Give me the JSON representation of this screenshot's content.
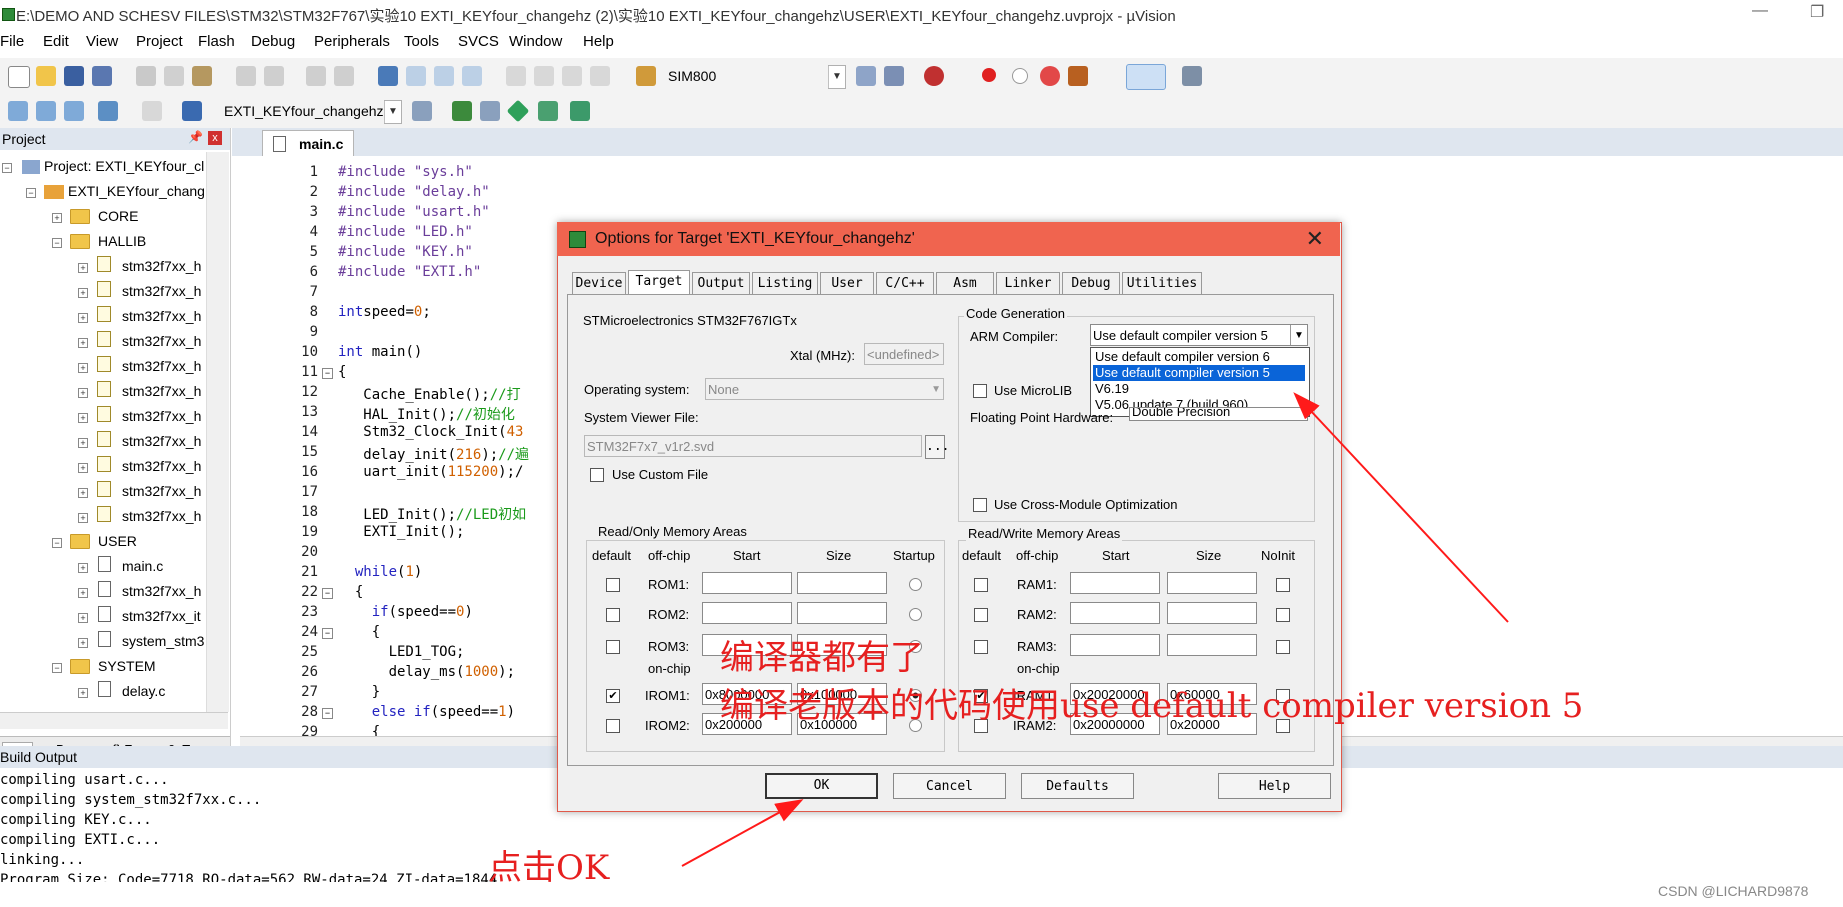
{
  "window": {
    "title": "E:\\DEMO AND SCHESV FILES\\STM32\\STM32F767\\实验10 EXTI_KEYfour_changehz (2)\\实验10 EXTI_KEYfour_changehz\\USER\\EXTI_KEYfour_changehz.uvprojx - µVision",
    "minimize": "—",
    "restore": "❐"
  },
  "menu": [
    "File",
    "Edit",
    "View",
    "Project",
    "Flash",
    "Debug",
    "Peripherals",
    "Tools",
    "SVCS",
    "Window",
    "Help"
  ],
  "toolbar": {
    "device_label": "SIM800",
    "target_label": "EXTI_KEYfour_changehz"
  },
  "project": {
    "header": "Project",
    "root": "Project: EXTI_KEYfour_cl",
    "target": "EXTI_KEYfour_chang",
    "groups": {
      "core": "CORE",
      "hallib": "HALLIB",
      "hallib_files": [
        "stm32f7xx_h",
        "stm32f7xx_h",
        "stm32f7xx_h",
        "stm32f7xx_h",
        "stm32f7xx_h",
        "stm32f7xx_h",
        "stm32f7xx_h",
        "stm32f7xx_h",
        "stm32f7xx_h",
        "stm32f7xx_h",
        "stm32f7xx_h"
      ],
      "user": "USER",
      "user_files": [
        "main.c",
        "stm32f7xx_h",
        "stm32f7xx_it",
        "system_stm3"
      ],
      "system": "SYSTEM",
      "system_files": [
        "delay.c"
      ]
    },
    "bottom_tabs": [
      "Pr...",
      "B...",
      "{} F...",
      "0. Te..."
    ]
  },
  "editor": {
    "tab": "main.c",
    "line_numbers": [
      "1",
      "2",
      "3",
      "4",
      "5",
      "6",
      "7",
      "8",
      "9",
      "10",
      "11",
      "12",
      "13",
      "14",
      "15",
      "16",
      "17",
      "18",
      "19",
      "20",
      "21",
      "22",
      "23",
      "24",
      "25",
      "26",
      "27",
      "28",
      "29"
    ],
    "lines": [
      [
        [
          "pp",
          "#include "
        ],
        [
          "str",
          "\"sys.h\""
        ]
      ],
      [
        [
          "pp",
          "#include "
        ],
        [
          "str",
          "\"delay.h\""
        ]
      ],
      [
        [
          "pp",
          "#include "
        ],
        [
          "str",
          "\"usart.h\""
        ]
      ],
      [
        [
          "pp",
          "#include "
        ],
        [
          "str",
          "\"LED.h\""
        ]
      ],
      [
        [
          "pp",
          "#include "
        ],
        [
          "str",
          "\"KEY.h\""
        ]
      ],
      [
        [
          "pp",
          "#include "
        ],
        [
          "str",
          "\"EXTI.h\""
        ]
      ],
      [],
      [
        [
          "kw",
          "int"
        ],
        [
          "",
          "speed="
        ],
        [
          "num",
          "0"
        ],
        [
          "",
          ";"
        ]
      ],
      [],
      [
        [
          "kw",
          "int"
        ],
        [
          "",
          " main()"
        ]
      ],
      [
        [
          "",
          "{"
        ]
      ],
      [
        [
          "",
          "   Cache_Enable();"
        ],
        [
          "cm",
          "//打"
        ]
      ],
      [
        [
          "",
          "   HAL_Init();"
        ],
        [
          "cm",
          "//初始化"
        ]
      ],
      [
        [
          "",
          "   Stm32_Clock_Init("
        ],
        [
          "num",
          "43"
        ]
      ],
      [
        [
          "",
          "   delay_init("
        ],
        [
          "num",
          "216"
        ],
        [
          "",
          ");"
        ],
        [
          "cm",
          "//遍"
        ]
      ],
      [
        [
          "",
          "   uart_init("
        ],
        [
          "num",
          "115200"
        ],
        [
          "",
          ");/"
        ]
      ],
      [],
      [
        [
          "",
          "   LED_Init();"
        ],
        [
          "cm",
          "//LED初如"
        ]
      ],
      [
        [
          "",
          "   EXTI_Init();"
        ]
      ],
      [],
      [
        [
          "",
          "  "
        ],
        [
          "kw",
          "while"
        ],
        [
          "",
          "("
        ],
        [
          "num",
          "1"
        ],
        [
          "",
          ")"
        ]
      ],
      [
        [
          "",
          "  {"
        ]
      ],
      [
        [
          "",
          "    "
        ],
        [
          "kw",
          "if"
        ],
        [
          "",
          "(speed=="
        ],
        [
          "num",
          "0"
        ],
        [
          "",
          ")"
        ]
      ],
      [
        [
          "",
          "    {"
        ]
      ],
      [
        [
          "",
          "      LED1_TOG;"
        ]
      ],
      [
        [
          "",
          "      delay_ms("
        ],
        [
          "num",
          "1000"
        ],
        [
          "",
          ");"
        ]
      ],
      [
        [
          "",
          "    }"
        ]
      ],
      [
        [
          "",
          "    "
        ],
        [
          "kw",
          "else if"
        ],
        [
          "",
          "(speed=="
        ],
        [
          "num",
          "1"
        ],
        [
          "",
          ")"
        ]
      ],
      [
        [
          "",
          "    {"
        ]
      ]
    ]
  },
  "build": {
    "header": "Build Output",
    "lines": [
      "compiling usart.c...",
      "compiling system_stm32f7xx.c...",
      "compiling KEY.c...",
      "compiling EXTI.c...",
      "linking...",
      "Program Size: Code=7718 RO-data=562 RW-data=24 ZI-data=1844"
    ]
  },
  "dialog": {
    "title": "Options for Target 'EXTI_KEYfour_changehz'",
    "close": "✕",
    "tabs": [
      "Device",
      "Target",
      "Output",
      "Listing",
      "User",
      "C/C++",
      "Asm",
      "Linker",
      "Debug",
      "Utilities"
    ],
    "active_tab": "Target",
    "device_name": "STMicroelectronics STM32F767IGTx",
    "xtal_label": "Xtal (MHz):",
    "xtal_value": "<undefined>",
    "os_label": "Operating system:",
    "os_value": "None",
    "svf_label": "System Viewer File:",
    "svf_value": "STM32F7x7_v1r2.svd",
    "svf_browse": "...",
    "custom_file_label": "Use Custom File",
    "code_gen": {
      "label": "Code Generation",
      "compiler_label": "ARM Compiler:",
      "compiler_value": "Use default compiler version 5",
      "options": [
        "Use default compiler version 6",
        "Use default compiler version 5",
        "V6.19",
        "V5.06 update 7 (build 960)"
      ],
      "selected_index": 1,
      "microlib_label": "Use MicroLIB",
      "fph_label": "Floating Point Hardware:",
      "fph_value": "Double Precision",
      "cross_module_label": "Use Cross-Module Optimization"
    },
    "ro": {
      "label": "Read/Only Memory Areas",
      "headers": [
        "default",
        "off-chip",
        "Start",
        "Size",
        "Startup"
      ],
      "rows": [
        {
          "name": "ROM1:",
          "start": "",
          "size": "",
          "checked": false
        },
        {
          "name": "ROM2:",
          "start": "",
          "size": "",
          "checked": false
        },
        {
          "name": "ROM3:",
          "start": "",
          "size": "",
          "checked": false
        },
        {
          "name": "IROM1:",
          "start": "0x8000000",
          "size": "0x100000",
          "checked": true
        },
        {
          "name": "IROM2:",
          "start": "0x200000",
          "size": "0x100000",
          "checked": false
        }
      ],
      "onchip": "on-chip"
    },
    "rw": {
      "label": "Read/Write Memory Areas",
      "headers": [
        "default",
        "off-chip",
        "Start",
        "Size",
        "NoInit"
      ],
      "rows": [
        {
          "name": "RAM1:",
          "start": "",
          "size": "",
          "checked": false
        },
        {
          "name": "RAM2:",
          "start": "",
          "size": "",
          "checked": false
        },
        {
          "name": "RAM3:",
          "start": "",
          "size": "",
          "checked": false
        },
        {
          "name": "IRAM1:",
          "start": "0x20020000",
          "size": "0x60000",
          "checked": true
        },
        {
          "name": "IRAM2:",
          "start": "0x20000000",
          "size": "0x20000",
          "checked": false
        }
      ],
      "onchip": "on-chip"
    },
    "buttons": {
      "ok": "OK",
      "cancel": "Cancel",
      "defaults": "Defaults",
      "help": "Help"
    }
  },
  "annotations": {
    "line1": "编译器都有了",
    "line2": "编译老版本的代码使用use default compiler version 5",
    "click_ok": "点击OK",
    "color": "#e62020"
  },
  "watermark": "CSDN @LICHARD9878"
}
